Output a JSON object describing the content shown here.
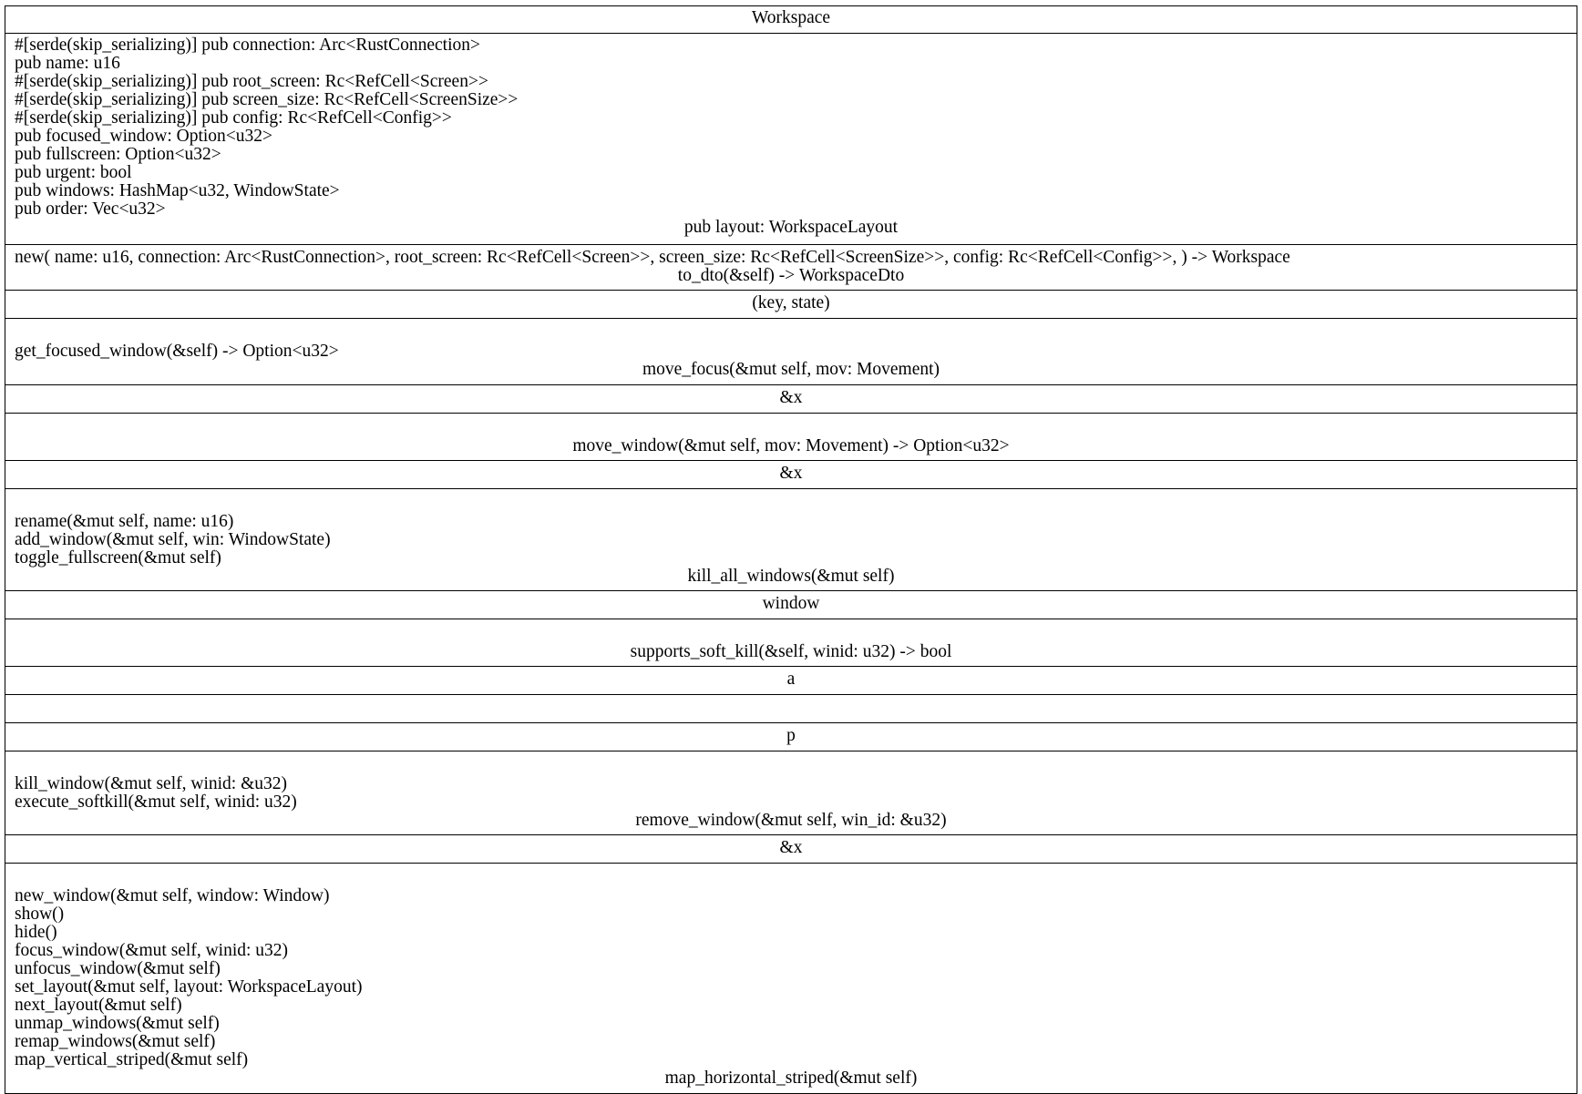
{
  "diagram": {
    "class_name": "Workspace",
    "fields": [
      "#[serde(skip_serializing)] pub connection: Arc<RustConnection>",
      "pub name: u16",
      "#[serde(skip_serializing)] pub root_screen: Rc<RefCell<Screen>>",
      "#[serde(skip_serializing)] pub screen_size: Rc<RefCell<ScreenSize>>",
      "#[serde(skip_serializing)] pub config: Rc<RefCell<Config>>",
      "pub focused_window: Option<u32>",
      "pub fullscreen: Option<u32>",
      "pub urgent: bool",
      "pub windows: HashMap<u32, WindowState>",
      "pub order: Vec<u32>",
      "pub layout: WorkspaceLayout"
    ],
    "methods_1": [
      "new( name: u16, connection: Arc<RustConnection>, root_screen: Rc<RefCell<Screen>>, screen_size: Rc<RefCell<ScreenSize>>, config: Rc<RefCell<Config>>, ) -> Workspace",
      "to_dto(&self) -> WorkspaceDto"
    ],
    "label_1": "(key, state)",
    "methods_2": [
      "get_focused_window(&self) -> Option<u32>",
      "move_focus(&mut self, mov: Movement)"
    ],
    "label_2": "&x",
    "methods_3": [
      "move_window(&mut self, mov: Movement) -> Option<u32>"
    ],
    "label_3": "&x",
    "methods_4": [
      "rename(&mut self, name: u16)",
      "add_window(&mut self, win: WindowState)",
      "toggle_fullscreen(&mut self)",
      "kill_all_windows(&mut self)"
    ],
    "label_4": "window",
    "methods_5": [
      "supports_soft_kill(&self, winid: u32) -> bool"
    ],
    "label_5": "a",
    "label_6": "p",
    "methods_6": [
      "kill_window(&mut self, winid: &u32)",
      "execute_softkill(&mut self, winid: u32)",
      "remove_window(&mut self, win_id: &u32)"
    ],
    "label_7": "&x",
    "methods_7": [
      "new_window(&mut self, window: Window)",
      "show()",
      "hide()",
      "focus_window(&mut self, winid: u32)",
      "unfocus_window(&mut self)",
      "set_layout(&mut self, layout: WorkspaceLayout)",
      "next_layout(&mut self)",
      "unmap_windows(&mut self)",
      "remap_windows(&mut self)",
      "map_vertical_striped(&mut self)",
      "map_horizontal_striped(&mut self)"
    ]
  }
}
